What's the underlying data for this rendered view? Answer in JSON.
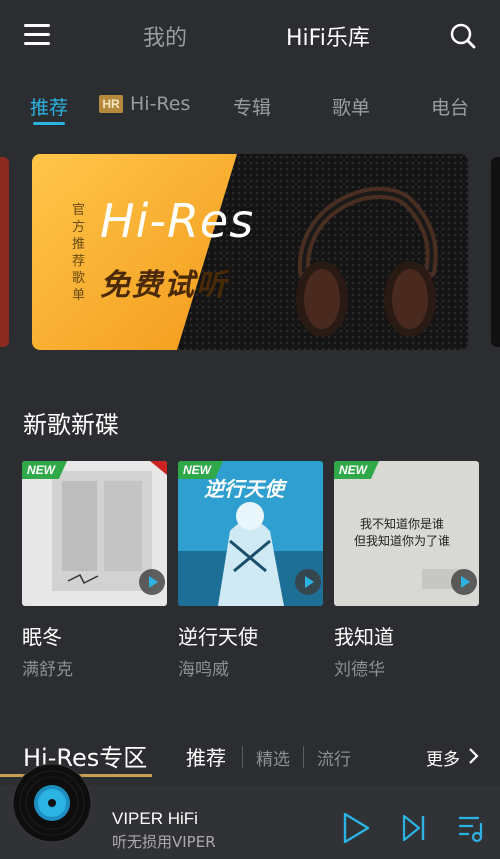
{
  "header": {
    "tab_mine": "我的",
    "tab_hifi": "HiFi乐库"
  },
  "subtabs": [
    {
      "label": "推荐",
      "active": true
    },
    {
      "badge": "HR",
      "label": "Hi-Res"
    },
    {
      "label": "专辑"
    },
    {
      "label": "歌单"
    },
    {
      "label": "电台"
    }
  ],
  "banner": {
    "vertical_text": "官方推荐歌单",
    "hires_text": "Hi-Res",
    "free_text": "免费试听"
  },
  "new_releases": {
    "title": "新歌新碟",
    "badge": "NEW",
    "albums": [
      {
        "name": "眠冬",
        "artist": "满舒克"
      },
      {
        "name": "逆行天使",
        "artist": "海鸣威",
        "cover_text": "逆行天使"
      },
      {
        "name": "我知道",
        "artist": "刘德华",
        "cover_line1": "我不知道你是谁",
        "cover_line2": "但我知道你为了谁"
      }
    ]
  },
  "hires_zone": {
    "title": "Hi-Res专区",
    "filters": [
      "推荐",
      "精选",
      "流行"
    ],
    "more": "更多"
  },
  "player": {
    "title": "VIPER HiFi",
    "subtitle": "听无损用VIPER"
  },
  "colors": {
    "accent": "#2bb3e3",
    "background": "#2b2d30",
    "gold": "#c89e53",
    "new_badge": "#2fa84a"
  }
}
